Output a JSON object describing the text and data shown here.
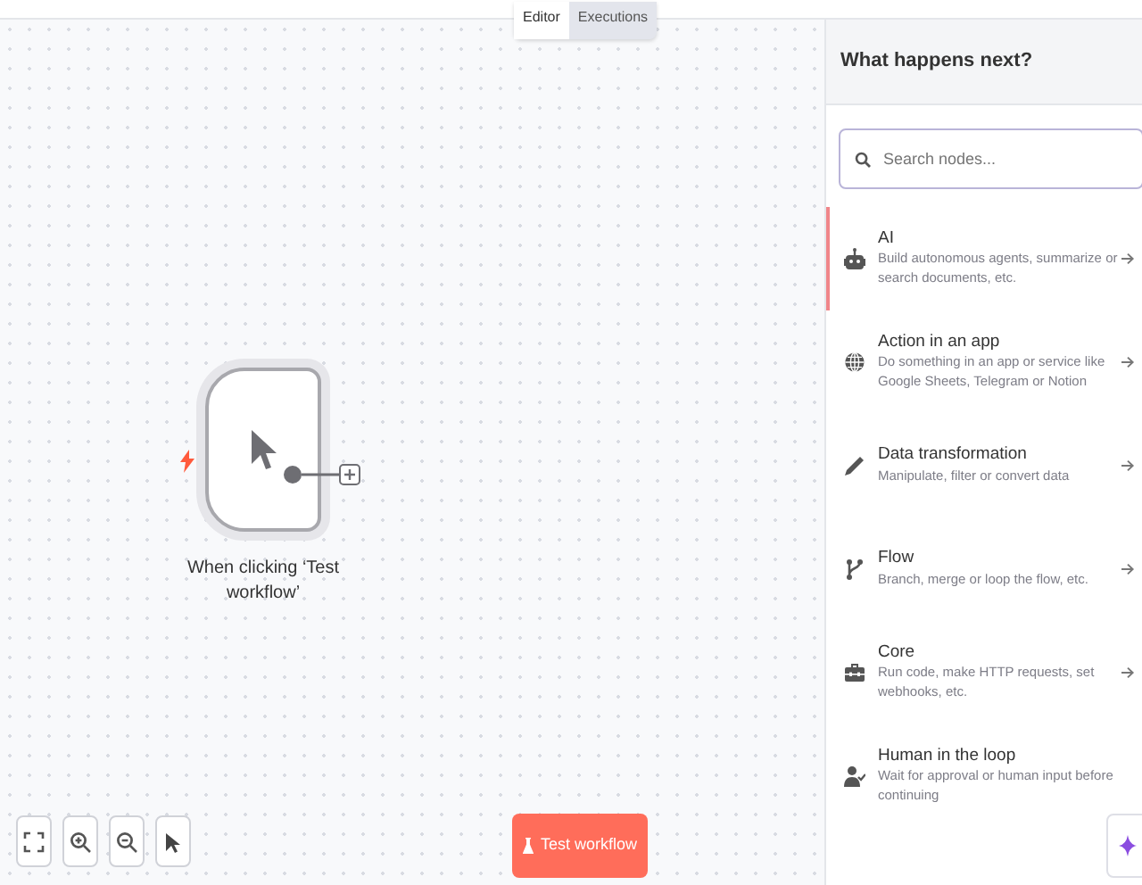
{
  "tabs": [
    {
      "label": "Editor",
      "selected": true
    },
    {
      "label": "Executions",
      "selected": false
    }
  ],
  "node": {
    "label": "When clicking ‘Test workflow’"
  },
  "canvas_controls": [
    {
      "kind": "fit"
    },
    {
      "kind": "zoom-in"
    },
    {
      "kind": "zoom-out"
    },
    {
      "kind": "pointer"
    }
  ],
  "test_button": {
    "label": "Test workflow"
  },
  "panel": {
    "title": "What happens next?",
    "search": {
      "placeholder": "Search nodes..."
    },
    "items": [
      {
        "kind": "robot",
        "title": "AI",
        "description": "Build autonomous agents, summarize or search documents, etc.",
        "selected": true,
        "arrow": true
      },
      {
        "kind": "globe",
        "title": "Action in an app",
        "description": "Do something in an app or service like Google Sheets, Telegram or Notion",
        "selected": false,
        "arrow": true
      },
      {
        "kind": "pen",
        "title": "Data transformation",
        "description": "Manipulate, filter or convert data",
        "selected": false,
        "arrow": true
      },
      {
        "kind": "branch",
        "title": "Flow",
        "description": "Branch, merge or loop the flow, etc.",
        "selected": false,
        "arrow": true
      },
      {
        "kind": "toolbox",
        "title": "Core",
        "description": "Run code, make HTTP requests, set webhooks, etc.",
        "selected": false,
        "arrow": true
      },
      {
        "kind": "person",
        "title": "Human in the loop",
        "description": "Wait for approval or human input before continuing",
        "selected": false,
        "arrow": false
      }
    ]
  }
}
